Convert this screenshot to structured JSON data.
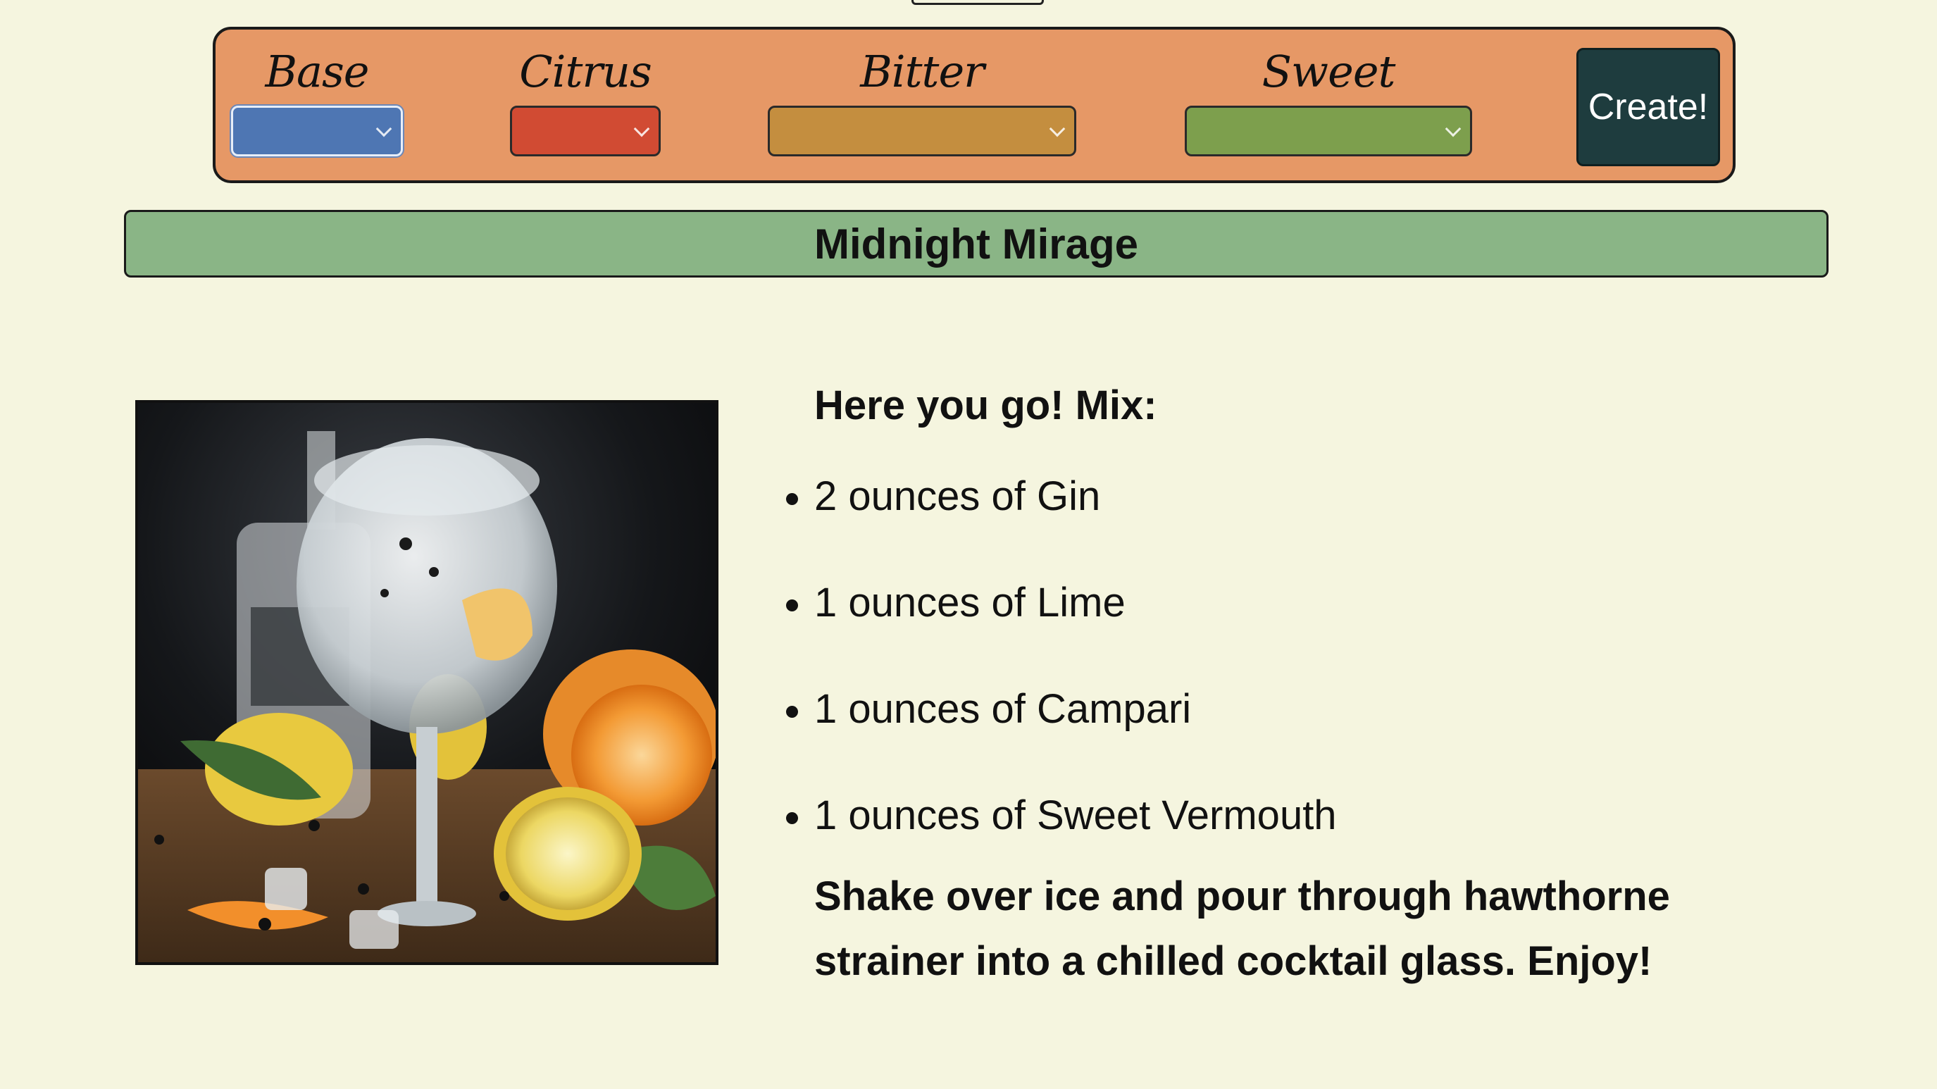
{
  "controls": {
    "base": {
      "label": "Base",
      "selected": "",
      "color": "#4e76b3"
    },
    "citrus": {
      "label": "Citrus",
      "selected": "",
      "color": "#d14b33"
    },
    "bitter": {
      "label": "Bitter",
      "selected": "",
      "color": "#c48e3f"
    },
    "sweet": {
      "label": "Sweet",
      "selected": "",
      "color": "#7d9f4d"
    },
    "create_label": "Create!",
    "panel_color": "#e69866",
    "button_color": "#1e3c3e"
  },
  "cocktail": {
    "name": "Midnight Mirage",
    "name_bar_color": "#8ab586",
    "intro": "Here you go! Mix:",
    "ingredients": [
      "2 ounces of Gin",
      "1 ounces of Lime",
      "1 ounces of Campari",
      "1 ounces of Sweet Vermouth"
    ],
    "instructions": "Shake over ice and pour through hawthorne strainer into a chilled cocktail glass. Enjoy!"
  },
  "image": {
    "icon": "cocktail-photo"
  },
  "colors": {
    "background": "#f5f5df"
  }
}
